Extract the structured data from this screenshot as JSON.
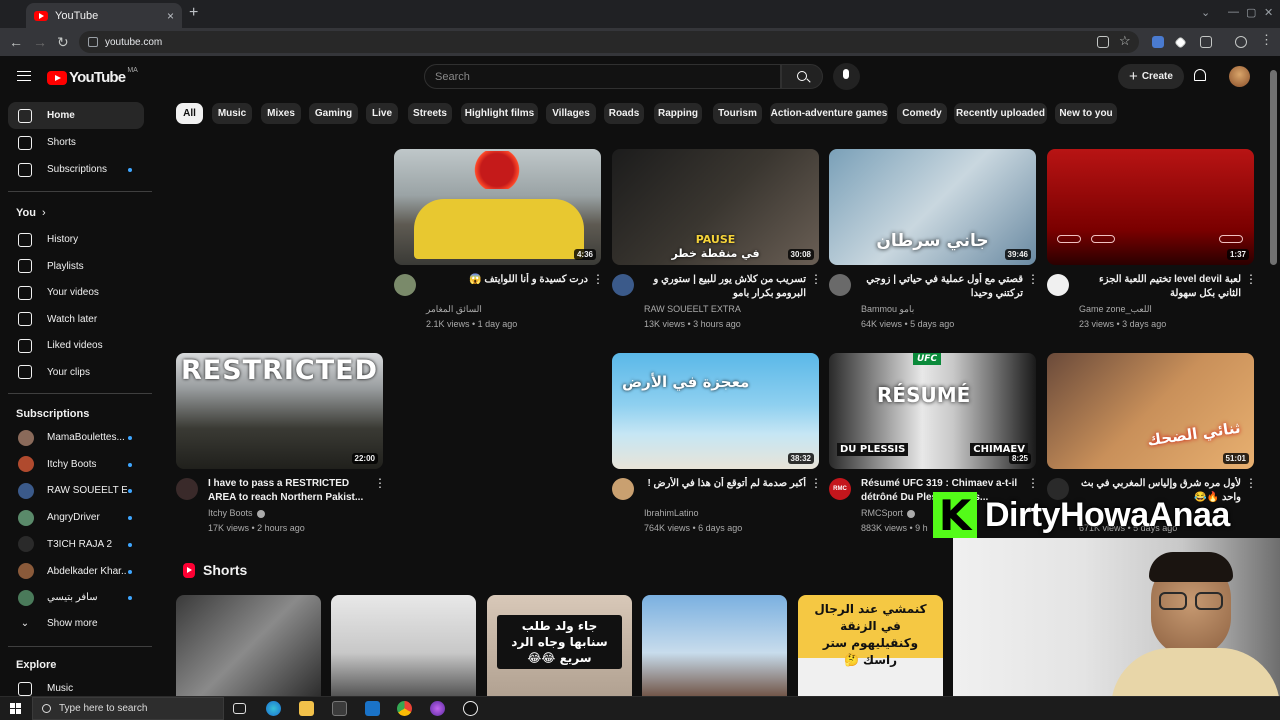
{
  "browser": {
    "tab_title": "YouTube",
    "tab_close": "×",
    "new_tab": "+",
    "url": "youtube.com",
    "back": "←",
    "forward": "→",
    "reload": "↻",
    "minimize": "—",
    "restore": "▢",
    "close": "✕"
  },
  "header": {
    "logo_text": "YouTube",
    "logo_country": "MA",
    "search_placeholder": "Search",
    "create_label": "Create",
    "create_plus": "+"
  },
  "sidebar": {
    "main": [
      {
        "label": "Home",
        "icon": "home-icon",
        "active": true
      },
      {
        "label": "Shorts",
        "icon": "shorts-icon"
      },
      {
        "label": "Subscriptions",
        "icon": "subscriptions-icon",
        "dot": true
      }
    ],
    "you_heading": "You",
    "you_chevron": "›",
    "you": [
      {
        "label": "History",
        "icon": "history-icon"
      },
      {
        "label": "Playlists",
        "icon": "playlists-icon"
      },
      {
        "label": "Your videos",
        "icon": "your-videos-icon"
      },
      {
        "label": "Watch later",
        "icon": "watch-later-icon"
      },
      {
        "label": "Liked videos",
        "icon": "liked-videos-icon"
      },
      {
        "label": "Your clips",
        "icon": "clips-icon"
      }
    ],
    "subs_heading": "Subscriptions",
    "subs": [
      {
        "label": "MamaBoulettes...",
        "color": "#8a6a5a"
      },
      {
        "label": "Itchy Boots",
        "color": "#b04a2e"
      },
      {
        "label": "RAW SOUEELT E...",
        "color": "#3b5a8a"
      },
      {
        "label": "AngryDriver",
        "color": "#5a8a6a"
      },
      {
        "label": "T3ICH RAJA 2",
        "color": "#2a2a2a"
      },
      {
        "label": "Abdelkader Khar...",
        "color": "#8a5a3a"
      },
      {
        "label": "سافر بتيسي",
        "color": "#4a7a5a"
      }
    ],
    "show_more": "Show more",
    "explore_heading": "Explore",
    "explore": [
      {
        "label": "Music",
        "icon": "music-icon"
      }
    ]
  },
  "chips": [
    "All",
    "Music",
    "Mixes",
    "Gaming",
    "Live",
    "Streets",
    "Highlight films",
    "Villages",
    "Roads",
    "Rapping",
    "Tourism",
    "Action-adventure games",
    "Comedy",
    "Recently uploaded",
    "New to you"
  ],
  "videos": [
    {
      "title": "درت كسيدة و أنا اللوايتف 😱",
      "channel": "السائق المغامر",
      "meta": "2.1K views • 1 day ago",
      "duration": "4:36",
      "rtl": true
    },
    {
      "title": "تسريب من كلاش يور للبيع | ستوري و البرومو بكرار بامو",
      "channel": "RAW SOUEELT EXTRA",
      "meta": "13K views • 3 hours ago",
      "duration": "30:08",
      "rtl": true,
      "thumb_text": "PAUSE",
      "thumb_text2": "في منقطة خطر"
    },
    {
      "title": "قصتي مع أول عملية في حياتي | زوجي تركتني وحيدا",
      "channel": "Bammou بامو",
      "meta": "64K views • 5 days ago",
      "duration": "39:46",
      "rtl": true,
      "thumb_text": "جاني سرطان"
    },
    {
      "title": "لعبة level devil تختيم اللعبة الجزء الثاني بكل سهولة",
      "channel": "Game zone_اللعب",
      "meta": "23 views • 3 days ago",
      "duration": "1:37",
      "rtl": true
    },
    {
      "title": "I have to pass a RESTRICTED AREA to reach Northern Pakist...",
      "channel": "Itchy Boots",
      "meta": "17K views • 2 hours ago",
      "duration": "22:00",
      "verified": true,
      "thumb_text": "RESTRICTED"
    },
    {
      "title": "أكبر صدمة لم أتوقع أن هذا في الأرض !",
      "channel": "IbrahimLatino",
      "meta": "764K views • 6 days ago",
      "duration": "38:32",
      "rtl": true,
      "thumb_text": "معجزة في الأرض"
    },
    {
      "title": "Résumé UFC 319 : Chimaev a-t-il détrôné Du Plessis ? Les...",
      "channel": "RMCSport",
      "meta": "883K views • 9 h",
      "duration": "8:25",
      "verified": true,
      "thumb_text": "RÉSUMÉ",
      "thumb_badge": "UFC",
      "thumb_left": "DU PLESSIS",
      "thumb_right": "CHIMAEV"
    },
    {
      "title": "لأول مره شرق وإلياس المغربي في بث واحد 🔥😂",
      "channel": "",
      "meta": "671K views • 5 days ago",
      "duration": "51:01",
      "rtl": true,
      "thumb_text": "ثنائي الضحك"
    }
  ],
  "shorts": {
    "title": "Shorts",
    "items": [
      {
        "text": ""
      },
      {
        "text": ""
      },
      {
        "text": "جاء ولد طلب سنابها وجاه الرد سريع 😂😂"
      },
      {
        "text": ""
      },
      {
        "text": "كنمشي عند الرجال في الزنقة وكنقيليهوم ستر راسك 🤔"
      }
    ]
  },
  "overlay": {
    "k_letter": "K",
    "streamer": "DirtyHowaAnaa"
  },
  "taskbar": {
    "search_placeholder": "Type here to search"
  },
  "colors": {
    "background": "#0f0f0f",
    "chip": "#272727",
    "accent_red": "#ff0000",
    "kick_green": "#53fc18"
  }
}
